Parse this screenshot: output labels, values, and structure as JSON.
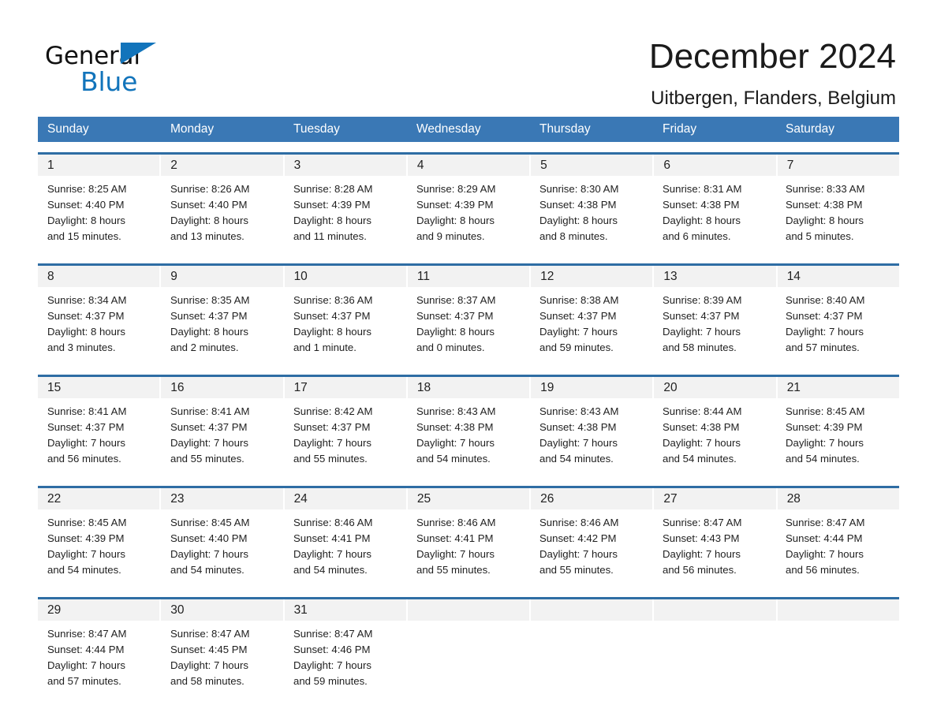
{
  "brand": {
    "name_part1": "General",
    "name_part2": "Blue",
    "triangle_color": "#1274bb"
  },
  "header": {
    "title": "December 2024",
    "subtitle": "Uitbergen, Flanders, Belgium"
  },
  "colors": {
    "header_blue": "#3a78b5",
    "row_rule_blue": "#2e6da4",
    "daynum_band": "#f2f2f2",
    "text": "#1f1f1f"
  },
  "weekdays": [
    "Sunday",
    "Monday",
    "Tuesday",
    "Wednesday",
    "Thursday",
    "Friday",
    "Saturday"
  ],
  "weeks": [
    {
      "days": [
        {
          "num": "1",
          "l1": "Sunrise: 8:25 AM",
          "l2": "Sunset: 4:40 PM",
          "l3": "Daylight: 8 hours",
          "l4": "and 15 minutes."
        },
        {
          "num": "2",
          "l1": "Sunrise: 8:26 AM",
          "l2": "Sunset: 4:40 PM",
          "l3": "Daylight: 8 hours",
          "l4": "and 13 minutes."
        },
        {
          "num": "3",
          "l1": "Sunrise: 8:28 AM",
          "l2": "Sunset: 4:39 PM",
          "l3": "Daylight: 8 hours",
          "l4": "and 11 minutes."
        },
        {
          "num": "4",
          "l1": "Sunrise: 8:29 AM",
          "l2": "Sunset: 4:39 PM",
          "l3": "Daylight: 8 hours",
          "l4": "and 9 minutes."
        },
        {
          "num": "5",
          "l1": "Sunrise: 8:30 AM",
          "l2": "Sunset: 4:38 PM",
          "l3": "Daylight: 8 hours",
          "l4": "and 8 minutes."
        },
        {
          "num": "6",
          "l1": "Sunrise: 8:31 AM",
          "l2": "Sunset: 4:38 PM",
          "l3": "Daylight: 8 hours",
          "l4": "and 6 minutes."
        },
        {
          "num": "7",
          "l1": "Sunrise: 8:33 AM",
          "l2": "Sunset: 4:38 PM",
          "l3": "Daylight: 8 hours",
          "l4": "and 5 minutes."
        }
      ]
    },
    {
      "days": [
        {
          "num": "8",
          "l1": "Sunrise: 8:34 AM",
          "l2": "Sunset: 4:37 PM",
          "l3": "Daylight: 8 hours",
          "l4": "and 3 minutes."
        },
        {
          "num": "9",
          "l1": "Sunrise: 8:35 AM",
          "l2": "Sunset: 4:37 PM",
          "l3": "Daylight: 8 hours",
          "l4": "and 2 minutes."
        },
        {
          "num": "10",
          "l1": "Sunrise: 8:36 AM",
          "l2": "Sunset: 4:37 PM",
          "l3": "Daylight: 8 hours",
          "l4": "and 1 minute."
        },
        {
          "num": "11",
          "l1": "Sunrise: 8:37 AM",
          "l2": "Sunset: 4:37 PM",
          "l3": "Daylight: 8 hours",
          "l4": "and 0 minutes."
        },
        {
          "num": "12",
          "l1": "Sunrise: 8:38 AM",
          "l2": "Sunset: 4:37 PM",
          "l3": "Daylight: 7 hours",
          "l4": "and 59 minutes."
        },
        {
          "num": "13",
          "l1": "Sunrise: 8:39 AM",
          "l2": "Sunset: 4:37 PM",
          "l3": "Daylight: 7 hours",
          "l4": "and 58 minutes."
        },
        {
          "num": "14",
          "l1": "Sunrise: 8:40 AM",
          "l2": "Sunset: 4:37 PM",
          "l3": "Daylight: 7 hours",
          "l4": "and 57 minutes."
        }
      ]
    },
    {
      "days": [
        {
          "num": "15",
          "l1": "Sunrise: 8:41 AM",
          "l2": "Sunset: 4:37 PM",
          "l3": "Daylight: 7 hours",
          "l4": "and 56 minutes."
        },
        {
          "num": "16",
          "l1": "Sunrise: 8:41 AM",
          "l2": "Sunset: 4:37 PM",
          "l3": "Daylight: 7 hours",
          "l4": "and 55 minutes."
        },
        {
          "num": "17",
          "l1": "Sunrise: 8:42 AM",
          "l2": "Sunset: 4:37 PM",
          "l3": "Daylight: 7 hours",
          "l4": "and 55 minutes."
        },
        {
          "num": "18",
          "l1": "Sunrise: 8:43 AM",
          "l2": "Sunset: 4:38 PM",
          "l3": "Daylight: 7 hours",
          "l4": "and 54 minutes."
        },
        {
          "num": "19",
          "l1": "Sunrise: 8:43 AM",
          "l2": "Sunset: 4:38 PM",
          "l3": "Daylight: 7 hours",
          "l4": "and 54 minutes."
        },
        {
          "num": "20",
          "l1": "Sunrise: 8:44 AM",
          "l2": "Sunset: 4:38 PM",
          "l3": "Daylight: 7 hours",
          "l4": "and 54 minutes."
        },
        {
          "num": "21",
          "l1": "Sunrise: 8:45 AM",
          "l2": "Sunset: 4:39 PM",
          "l3": "Daylight: 7 hours",
          "l4": "and 54 minutes."
        }
      ]
    },
    {
      "days": [
        {
          "num": "22",
          "l1": "Sunrise: 8:45 AM",
          "l2": "Sunset: 4:39 PM",
          "l3": "Daylight: 7 hours",
          "l4": "and 54 minutes."
        },
        {
          "num": "23",
          "l1": "Sunrise: 8:45 AM",
          "l2": "Sunset: 4:40 PM",
          "l3": "Daylight: 7 hours",
          "l4": "and 54 minutes."
        },
        {
          "num": "24",
          "l1": "Sunrise: 8:46 AM",
          "l2": "Sunset: 4:41 PM",
          "l3": "Daylight: 7 hours",
          "l4": "and 54 minutes."
        },
        {
          "num": "25",
          "l1": "Sunrise: 8:46 AM",
          "l2": "Sunset: 4:41 PM",
          "l3": "Daylight: 7 hours",
          "l4": "and 55 minutes."
        },
        {
          "num": "26",
          "l1": "Sunrise: 8:46 AM",
          "l2": "Sunset: 4:42 PM",
          "l3": "Daylight: 7 hours",
          "l4": "and 55 minutes."
        },
        {
          "num": "27",
          "l1": "Sunrise: 8:47 AM",
          "l2": "Sunset: 4:43 PM",
          "l3": "Daylight: 7 hours",
          "l4": "and 56 minutes."
        },
        {
          "num": "28",
          "l1": "Sunrise: 8:47 AM",
          "l2": "Sunset: 4:44 PM",
          "l3": "Daylight: 7 hours",
          "l4": "and 56 minutes."
        }
      ]
    },
    {
      "days": [
        {
          "num": "29",
          "l1": "Sunrise: 8:47 AM",
          "l2": "Sunset: 4:44 PM",
          "l3": "Daylight: 7 hours",
          "l4": "and 57 minutes."
        },
        {
          "num": "30",
          "l1": "Sunrise: 8:47 AM",
          "l2": "Sunset: 4:45 PM",
          "l3": "Daylight: 7 hours",
          "l4": "and 58 minutes."
        },
        {
          "num": "31",
          "l1": "Sunrise: 8:47 AM",
          "l2": "Sunset: 4:46 PM",
          "l3": "Daylight: 7 hours",
          "l4": "and 59 minutes."
        },
        {
          "num": "",
          "l1": "",
          "l2": "",
          "l3": "",
          "l4": ""
        },
        {
          "num": "",
          "l1": "",
          "l2": "",
          "l3": "",
          "l4": ""
        },
        {
          "num": "",
          "l1": "",
          "l2": "",
          "l3": "",
          "l4": ""
        },
        {
          "num": "",
          "l1": "",
          "l2": "",
          "l3": "",
          "l4": ""
        }
      ]
    }
  ]
}
